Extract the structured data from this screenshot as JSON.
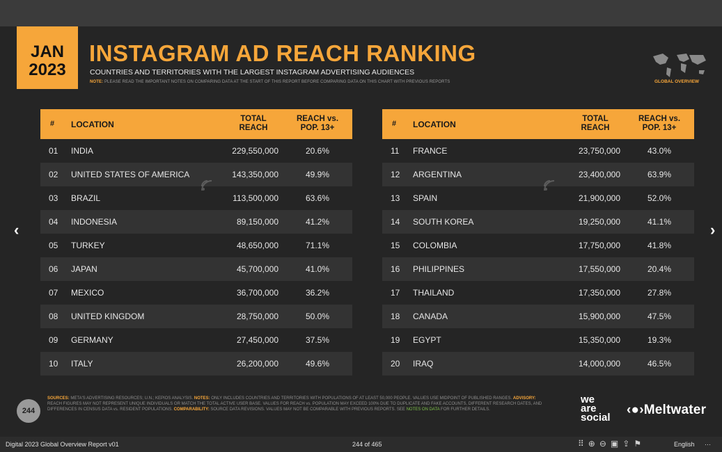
{
  "header": {
    "month": "JAN",
    "year": "2023",
    "title": "INSTAGRAM AD REACH RANKING",
    "subtitle": "COUNTRIES AND TERRITORIES WITH THE LARGEST INSTAGRAM ADVERTISING AUDIENCES",
    "note_label": "NOTE:",
    "note_text": "PLEASE READ THE IMPORTANT NOTES ON COMPARING DATA AT THE START OF THIS REPORT BEFORE COMPARING DATA ON THIS CHART WITH PREVIOUS REPORTS",
    "section_label": "GLOBAL OVERVIEW"
  },
  "table": {
    "col_rank": "#",
    "col_location": "LOCATION",
    "col_total_1": "TOTAL",
    "col_total_2": "REACH",
    "col_reach_1": "REACH vs.",
    "col_reach_2": "POP. 13+",
    "rows": [
      {
        "rank": "01",
        "location": "INDIA",
        "total": "229,550,000",
        "reach": "20.6%"
      },
      {
        "rank": "02",
        "location": "UNITED STATES OF AMERICA",
        "total": "143,350,000",
        "reach": "49.9%"
      },
      {
        "rank": "03",
        "location": "BRAZIL",
        "total": "113,500,000",
        "reach": "63.6%"
      },
      {
        "rank": "04",
        "location": "INDONESIA",
        "total": "89,150,000",
        "reach": "41.2%"
      },
      {
        "rank": "05",
        "location": "TURKEY",
        "total": "48,650,000",
        "reach": "71.1%"
      },
      {
        "rank": "06",
        "location": "JAPAN",
        "total": "45,700,000",
        "reach": "41.0%"
      },
      {
        "rank": "07",
        "location": "MEXICO",
        "total": "36,700,000",
        "reach": "36.2%"
      },
      {
        "rank": "08",
        "location": "UNITED KINGDOM",
        "total": "28,750,000",
        "reach": "50.0%"
      },
      {
        "rank": "09",
        "location": "GERMANY",
        "total": "27,450,000",
        "reach": "37.5%"
      },
      {
        "rank": "10",
        "location": "ITALY",
        "total": "26,200,000",
        "reach": "49.6%"
      },
      {
        "rank": "11",
        "location": "FRANCE",
        "total": "23,750,000",
        "reach": "43.0%"
      },
      {
        "rank": "12",
        "location": "ARGENTINA",
        "total": "23,400,000",
        "reach": "63.9%"
      },
      {
        "rank": "13",
        "location": "SPAIN",
        "total": "21,900,000",
        "reach": "52.0%"
      },
      {
        "rank": "14",
        "location": "SOUTH KOREA",
        "total": "19,250,000",
        "reach": "41.1%"
      },
      {
        "rank": "15",
        "location": "COLOMBIA",
        "total": "17,750,000",
        "reach": "41.8%"
      },
      {
        "rank": "16",
        "location": "PHILIPPINES",
        "total": "17,550,000",
        "reach": "20.4%"
      },
      {
        "rank": "17",
        "location": "THAILAND",
        "total": "17,350,000",
        "reach": "27.8%"
      },
      {
        "rank": "18",
        "location": "CANADA",
        "total": "15,900,000",
        "reach": "47.5%"
      },
      {
        "rank": "19",
        "location": "EGYPT",
        "total": "15,350,000",
        "reach": "19.3%"
      },
      {
        "rank": "20",
        "location": "IRAQ",
        "total": "14,000,000",
        "reach": "46.5%"
      }
    ]
  },
  "footer": {
    "page_number": "244",
    "sources_label": "SOURCES:",
    "sources_text": "META'S ADVERTISING RESOURCES; U.N.; KEPIOS ANALYSIS.",
    "notes_label": "NOTES:",
    "notes_text": "ONLY INCLUDES COUNTRIES AND TERRITORIES WITH POPULATIONS OF AT LEAST 50,000 PEOPLE. VALUES USE MIDPOINT OF PUBLISHED RANGES.",
    "advisory_label": "ADVISORY:",
    "advisory_text": "REACH FIGURES MAY NOT REPRESENT UNIQUE INDIVIDUALS OR MATCH THE TOTAL ACTIVE USER BASE. VALUES FOR REACH vs. POPULATION MAY EXCEED 100% DUE TO DUPLICATE AND FAKE ACCOUNTS, DIFFERENT RESEARCH DATES, AND DIFFERENCES IN CENSUS DATA vs. RESIDENT POPULATIONS.",
    "comparability_label": "COMPARABILITY:",
    "comparability_text": "SOURCE DATA REVISIONS. VALUES MAY NOT BE COMPARABLE WITH PREVIOUS REPORTS. SEE",
    "notes_link": "NOTES ON DATA",
    "comparability_end": "FOR FURTHER DETAILS.",
    "brand_was_1": "we",
    "brand_was_2": "are",
    "brand_was_3": "social",
    "brand_meltwater": "Meltwater"
  },
  "viewer": {
    "doc_title": "Digital 2023 Global Overview Report v01",
    "page_indicator": "244 of 465",
    "language": "English",
    "more": "···"
  },
  "colors": {
    "accent": "#f6a63a",
    "slide_bg": "#252525",
    "row_alt": "#333333"
  }
}
